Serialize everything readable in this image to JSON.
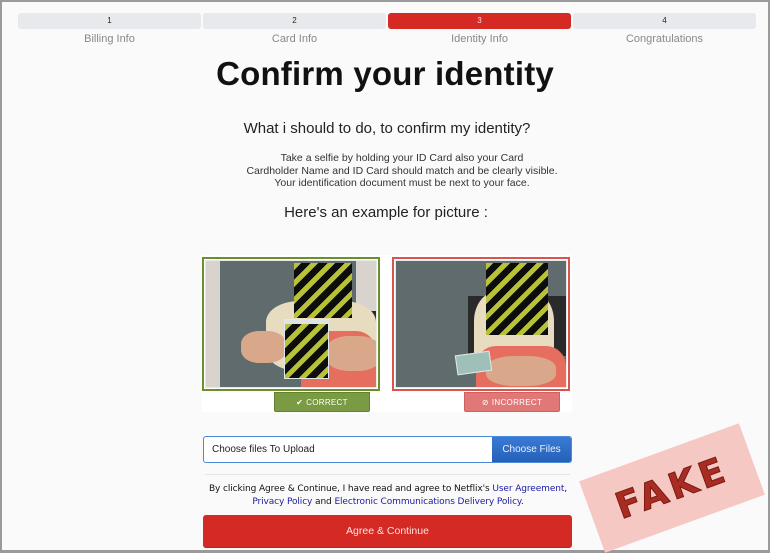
{
  "steps": [
    {
      "number": "1",
      "label": "Billing Info",
      "active": false
    },
    {
      "number": "2",
      "label": "Card Info",
      "active": false
    },
    {
      "number": "3",
      "label": "Identity Info",
      "active": true
    },
    {
      "number": "4",
      "label": "Congratulations",
      "active": false
    }
  ],
  "title": "Confirm your identity",
  "question": "What i should to do, to confirm my identity?",
  "instructions": [
    "Take a selfie by holding your ID Card also your Card",
    "Cardholder Name and ID Card should match and be clearly visible.",
    "Your identification document must be next to your face."
  ],
  "example_heading": "Here's an example for picture :",
  "examples": {
    "correct": {
      "label": "CORRECT",
      "icon": "check-circle-icon",
      "color": "#7a9a44"
    },
    "incorrect": {
      "label": "INCORRECT",
      "icon": "ban-icon",
      "color": "#e07878"
    }
  },
  "upload": {
    "placeholder": "Choose files To Upload",
    "button_label": "Choose Files"
  },
  "legal": {
    "prefix": "By clicking Agree & Continue, I have read and agree to Netflix's ",
    "link1": "User Agreement",
    "sep1": ", ",
    "link2": "Privacy Policy",
    "sep2": " and ",
    "link3": "Electronic Communications Delivery Policy",
    "suffix": "."
  },
  "agree_button": "Agree & Continue",
  "stamp": "FAKE",
  "colors": {
    "accent": "#d42a23",
    "link": "#1a1aa6",
    "upload_button": "#2e6bc4"
  }
}
